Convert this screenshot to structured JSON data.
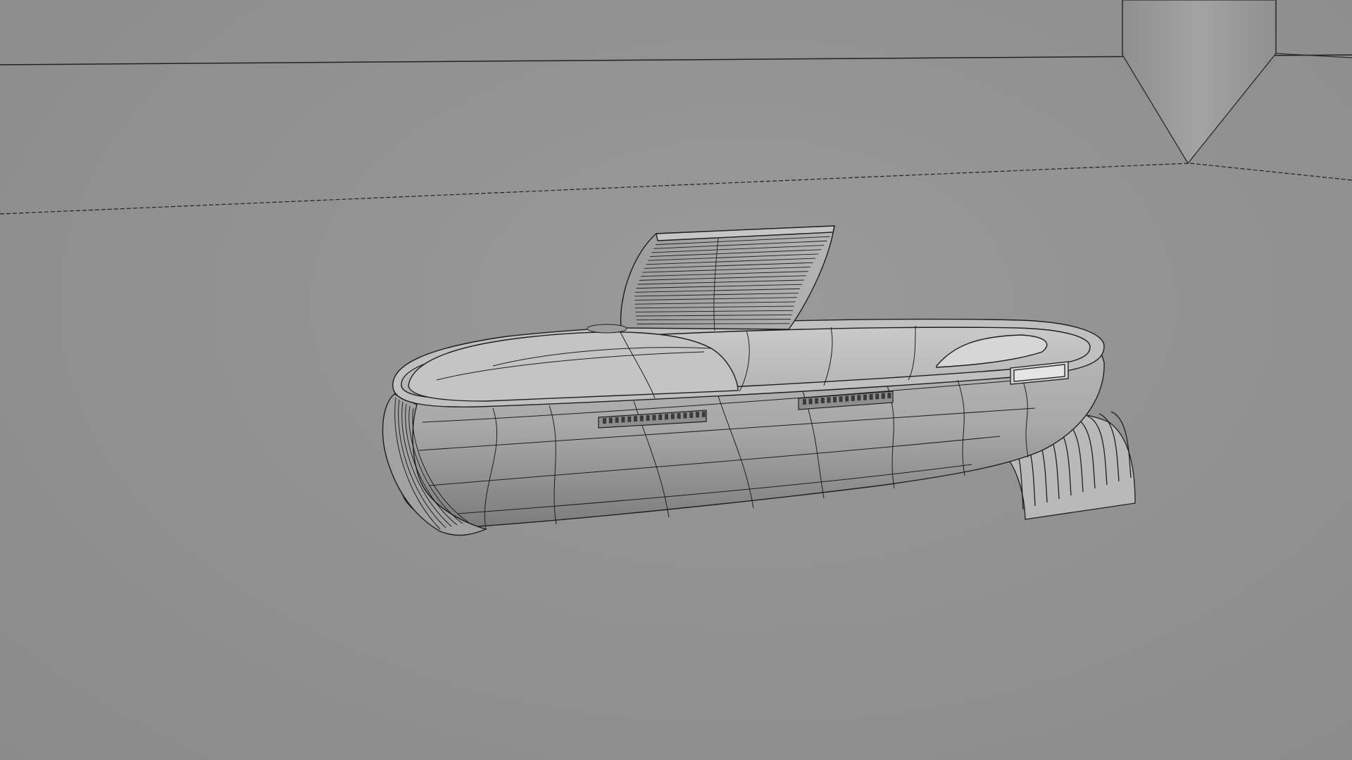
{
  "viewport": {
    "background": "#929292",
    "shading_mode": "wireframe-on-shaded",
    "wire_color": "#1e1e1e"
  },
  "scene_objects": [
    "floor-plane",
    "funnel-prop",
    "hull",
    "hatch-door",
    "vent-panel-left",
    "vent-panel-right",
    "window-slot",
    "tail-fin"
  ]
}
